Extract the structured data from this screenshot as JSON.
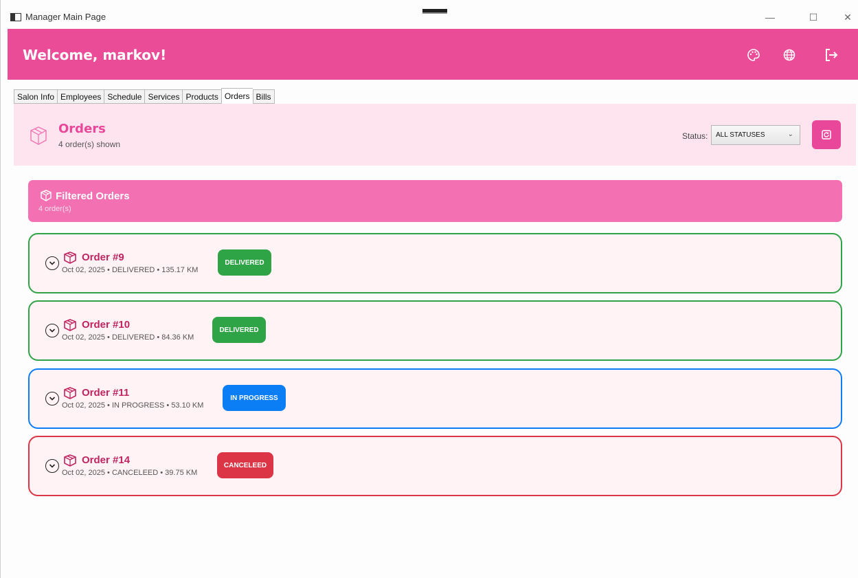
{
  "window": {
    "title": "Manager Main Page",
    "controls": {
      "minimize": "—",
      "maximize": "☐",
      "close": "✕"
    }
  },
  "header": {
    "welcome": "Welcome, markov!",
    "color": "#ea4c98",
    "buttons": [
      "palette-icon",
      "globe-icon",
      "logout-icon"
    ]
  },
  "tabs": [
    {
      "label": "Salon Info",
      "active": false
    },
    {
      "label": "Employees",
      "active": false
    },
    {
      "label": "Schedule",
      "active": false
    },
    {
      "label": "Services",
      "active": false
    },
    {
      "label": "Products",
      "active": false
    },
    {
      "label": "Orders",
      "active": true
    },
    {
      "label": "Bills",
      "active": false
    }
  ],
  "page": {
    "title": "Orders",
    "subtitle": "4 order(s) shown",
    "status_label": "Status:",
    "status_value": "ALL STATUSES",
    "accent": "#e8479a"
  },
  "filtered": {
    "title": "Filtered Orders",
    "count": "4 order(s)"
  },
  "orders": [
    {
      "title": "Order #9",
      "details": "Oct 02, 2025 • DELIVERED • 135.17 KM",
      "badge": "DELIVERED",
      "color": "#2ea446"
    },
    {
      "title": "Order #10",
      "details": "Oct 02, 2025 • DELIVERED • 84.36 KM",
      "badge": "DELIVERED",
      "color": "#2ea446"
    },
    {
      "title": "Order #11",
      "details": "Oct 02, 2025 • IN PROGRESS • 53.10 KM",
      "badge": "IN PROGRESS",
      "color": "#0b7df5"
    },
    {
      "title": "Order #14",
      "details": "Oct 02, 2025 • CANCELEED • 39.75 KM",
      "badge": "CANCELEED",
      "color": "#dc3545"
    }
  ]
}
